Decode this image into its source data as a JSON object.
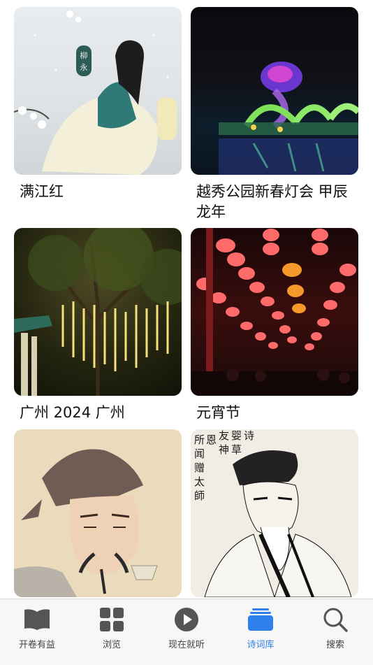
{
  "cards": [
    {
      "title": "满江红"
    },
    {
      "title": "越秀公园新春灯会 甲辰龙年"
    },
    {
      "title": "广州 2024 广州"
    },
    {
      "title": "元宵节"
    },
    {
      "title": ""
    },
    {
      "title": ""
    }
  ],
  "image_text": {
    "card1_seal": "柳永",
    "card6_inscription_col1": "友神",
    "card6_inscription_col2": "婴草",
    "card6_inscription_col3": "诗",
    "card6_side_col1": "所",
    "card6_side_col2": "赠太師"
  },
  "tabbar": {
    "items": [
      {
        "label": "开卷有益",
        "icon": "book-icon"
      },
      {
        "label": "浏览",
        "icon": "grid-icon"
      },
      {
        "label": "现在就听",
        "icon": "play-icon"
      },
      {
        "label": "诗词库",
        "icon": "library-icon"
      },
      {
        "label": "搜索",
        "icon": "search-icon"
      }
    ],
    "active_index": 3,
    "active_color": "#2f80ed",
    "inactive_color": "#555555"
  }
}
